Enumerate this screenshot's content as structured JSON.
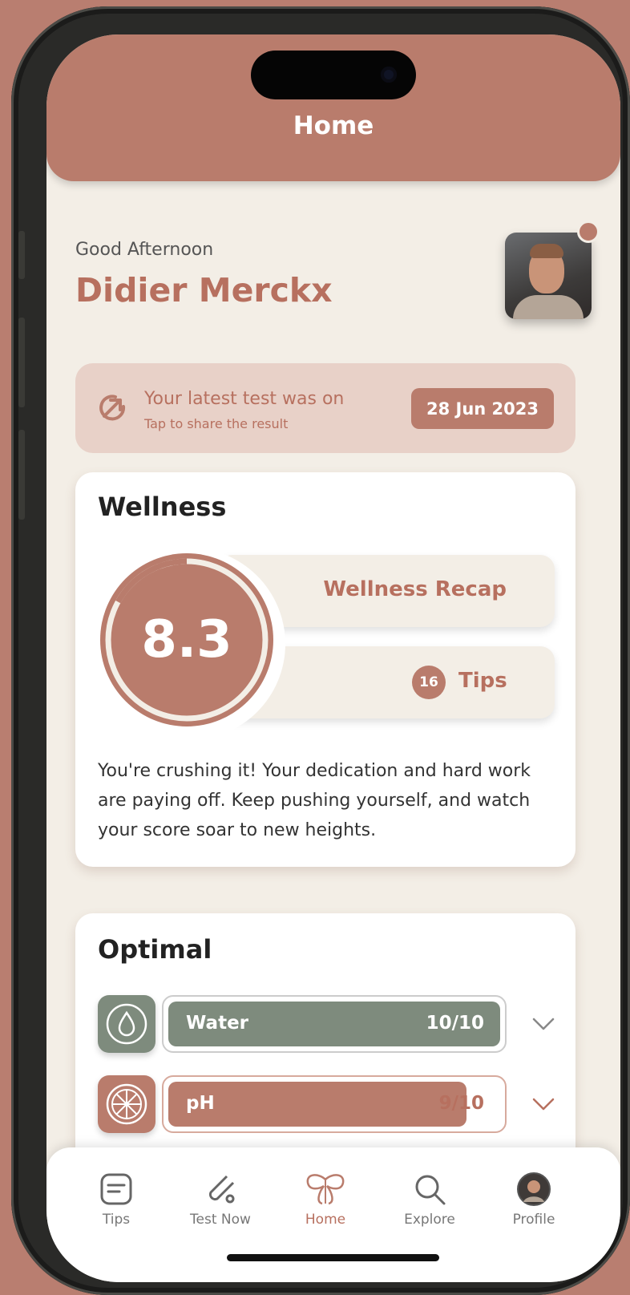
{
  "header": {
    "title": "Home"
  },
  "greeting": {
    "salutation": "Good Afternoon",
    "name": "Didier Merckx"
  },
  "latest_test": {
    "line1": "Your latest test was on",
    "line2": "Tap to share the result",
    "date": "28 Jun 2023"
  },
  "wellness": {
    "title": "Wellness",
    "score": "8.3",
    "score_fraction": 0.83,
    "recap_label": "Wellness Recap",
    "tips_count": "16",
    "tips_label": "Tips",
    "description": "You're crushing it! Your dedication and hard work are paying off. Keep pushing yourself, and watch your score soar to new heights."
  },
  "optimal": {
    "title": "Optimal",
    "items": [
      {
        "name": "Water",
        "score": "10/10",
        "level": 1.0,
        "icon": "water-drop-icon",
        "color": "#7e8b7d"
      },
      {
        "name": "pH",
        "score": "9/10",
        "level": 0.9,
        "icon": "citrus-icon",
        "color": "#b97c6c"
      }
    ]
  },
  "tabbar": {
    "tabs": [
      {
        "label": "Tips",
        "icon": "tips-icon"
      },
      {
        "label": "Test Now",
        "icon": "test-tube-icon"
      },
      {
        "label": "Home",
        "icon": "butterfly-logo-icon",
        "active": true
      },
      {
        "label": "Explore",
        "icon": "search-icon"
      },
      {
        "label": "Profile",
        "icon": "profile-avatar-icon"
      }
    ]
  },
  "colors": {
    "brand": "#b97c6c",
    "sage": "#7e8b7d",
    "background": "#f3eee6"
  }
}
